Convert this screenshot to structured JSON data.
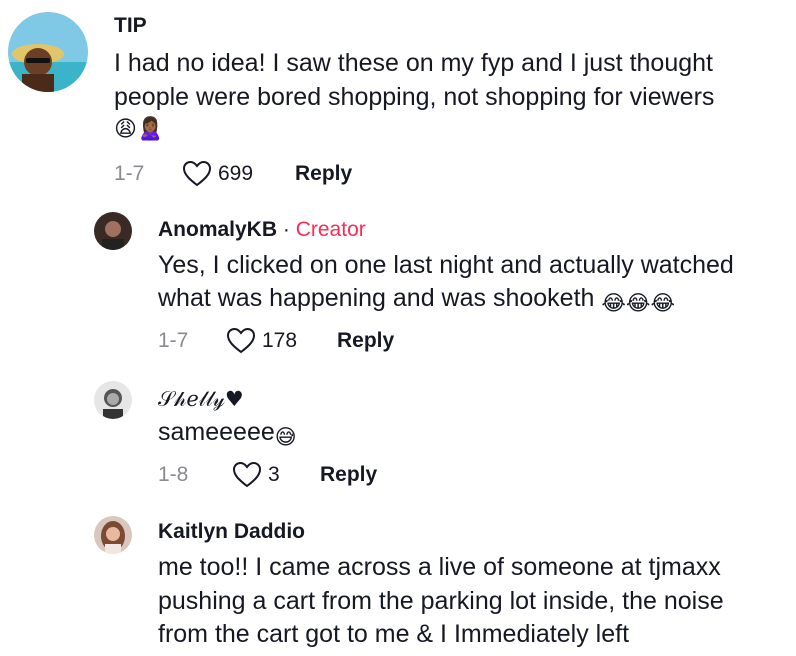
{
  "comments": [
    {
      "username": "TIP",
      "creator_label": "",
      "lines": [
        "I had no idea! I saw these on my fyp and I just thought",
        "people were bored shopping, not shopping for viewers"
      ],
      "emoji_line": "😩🙎🏾‍♀️",
      "date": "1-7",
      "likes": "699",
      "reply_label": "Reply"
    },
    {
      "username": "AnomalyKB",
      "separator": "·",
      "creator_label": "Creator",
      "lines": [
        "Yes, I clicked on one last night and actually watched",
        "what was happening and was shooketh"
      ],
      "emoji_tail": "😂😂😂",
      "date": "1-7",
      "likes": "178",
      "reply_label": "Reply"
    },
    {
      "username": "𝒮𝒽𝑒𝓁𝓁𝓎♥",
      "lines": [
        "sameeeee"
      ],
      "emoji_tail": "😅",
      "date": "1-8",
      "likes": "3",
      "reply_label": "Reply"
    },
    {
      "username": "Kaitlyn Daddio",
      "lines": [
        "me too!! I came across a live of someone at tjmaxx",
        "pushing a cart from the parking lot inside, the noise",
        "from the cart got to me & I Immediately left"
      ]
    }
  ],
  "icons": {
    "like": "heart-outline-icon"
  },
  "colors": {
    "creator": "#fe2c55",
    "meta": "#8a8b91",
    "text": "#161823"
  }
}
